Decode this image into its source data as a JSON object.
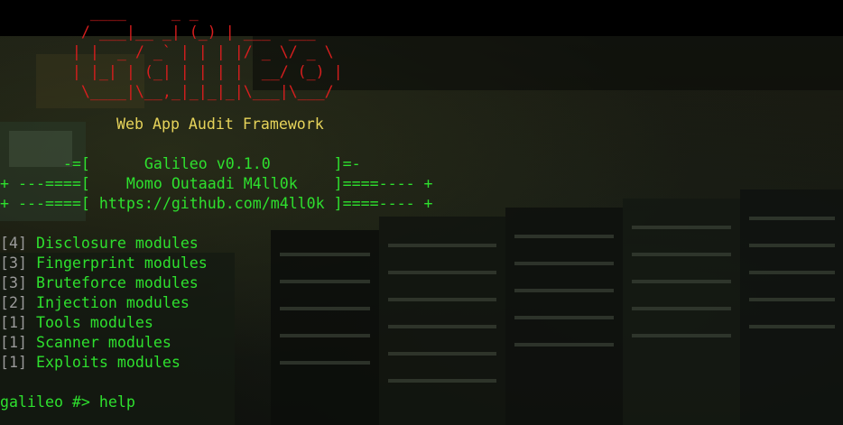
{
  "banner": {
    "ascii_art": [
      "          ____     _ _",
      "         / ___|__ _| (_) | ___  ___",
      "        | |  _ / _` | | | |/ _ \\/ _ \\",
      "        | |_| | (_| | | | |  __/ (_) |",
      "         \\____|\\__,_|_|_|_|\\___|\\___/"
    ],
    "subtitle": "Web App Audit Framework",
    "info_lines": [
      "       -=[      Galileo v0.1.0       ]=-",
      "+ ---====[    Momo Outaadi M4ll0k    ]====---- +",
      "+ ---====[ https://github.com/m4ll0k ]====---- +"
    ]
  },
  "modules": [
    {
      "count": "[4]",
      "label": " Disclosure modules"
    },
    {
      "count": "[3]",
      "label": " Fingerprint modules"
    },
    {
      "count": "[3]",
      "label": " Bruteforce modules"
    },
    {
      "count": "[2]",
      "label": " Injection modules"
    },
    {
      "count": "[1]",
      "label": " Tools modules"
    },
    {
      "count": "[1]",
      "label": " Scanner modules"
    },
    {
      "count": "[1]",
      "label": " Exploits modules"
    }
  ],
  "prompt": {
    "text": "galileo #> help"
  },
  "colors": {
    "banner": "#d81e1e",
    "subtitle": "#e6d35a",
    "text": "#2ee02e",
    "counts": "#9a9a9a",
    "background": "#000000"
  }
}
